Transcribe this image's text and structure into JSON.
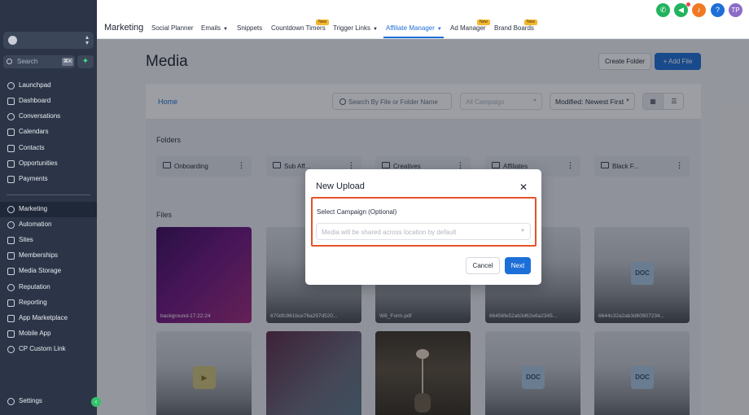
{
  "sidebar": {
    "search_placeholder": "Search",
    "search_shortcut": "⌘K",
    "items": [
      {
        "label": "Launchpad",
        "icon": "rocket-icon"
      },
      {
        "label": "Dashboard",
        "icon": "dashboard-icon"
      },
      {
        "label": "Conversations",
        "icon": "chat-icon"
      },
      {
        "label": "Calendars",
        "icon": "calendar-icon"
      },
      {
        "label": "Contacts",
        "icon": "contacts-icon"
      },
      {
        "label": "Opportunities",
        "icon": "opportunities-icon"
      },
      {
        "label": "Payments",
        "icon": "payments-icon"
      },
      {
        "label": "Marketing",
        "icon": "send-icon"
      },
      {
        "label": "Automation",
        "icon": "automation-icon"
      },
      {
        "label": "Sites",
        "icon": "sites-icon"
      },
      {
        "label": "Memberships",
        "icon": "memberships-icon"
      },
      {
        "label": "Media Storage",
        "icon": "media-icon"
      },
      {
        "label": "Reputation",
        "icon": "star-icon"
      },
      {
        "label": "Reporting",
        "icon": "reporting-icon"
      },
      {
        "label": "App Marketplace",
        "icon": "marketplace-icon"
      },
      {
        "label": "Mobile App",
        "icon": "mobile-icon"
      },
      {
        "label": "CP Custom Link",
        "icon": "link-icon"
      }
    ],
    "settings_label": "Settings",
    "active_item": "Marketing"
  },
  "topbar": {
    "title": "Marketing",
    "tabs": [
      {
        "label": "Social Planner"
      },
      {
        "label": "Emails",
        "dropdown": true
      },
      {
        "label": "Snippets"
      },
      {
        "label": "Countdown Timers",
        "badge": "New"
      },
      {
        "label": "Trigger Links",
        "dropdown": true
      },
      {
        "label": "Affiliate Manager",
        "dropdown": true,
        "active": true
      },
      {
        "label": "Ad Manager",
        "badge": "New"
      },
      {
        "label": "Brand Boards",
        "badge": "New"
      }
    ],
    "avatar_initials": "TP",
    "accent_color": "#1d6fd8"
  },
  "page": {
    "title": "Media",
    "create_folder_label": "Create Folder",
    "add_file_label": "Add File",
    "breadcrumb_home": "Home",
    "search_placeholder": "Search By File or Folder Name",
    "campaign_placeholder": "All Campaign",
    "sort_value": "Modified: Newest First",
    "folders_heading": "Folders",
    "files_heading": "Files",
    "folders": [
      "Onboarding",
      "Sub Aff...",
      "Creatives",
      "Affiliates",
      "Black F..."
    ],
    "files": [
      {
        "name": "background-17:22:24",
        "kind": "image"
      },
      {
        "name": "670dfc961bce76a297d520...",
        "kind": "image"
      },
      {
        "name": "W8_Form.pdf",
        "kind": "pdf"
      },
      {
        "name": "66456fe52ab3d62e6a2345...",
        "kind": "image"
      },
      {
        "name": "6644c32a2ab3d60907234...",
        "kind": "doc",
        "badge": "DOC"
      },
      {
        "name": "",
        "kind": "video"
      },
      {
        "name": "",
        "kind": "image"
      },
      {
        "name": "",
        "kind": "photo"
      },
      {
        "name": "",
        "kind": "doc",
        "badge": "DOC"
      },
      {
        "name": "",
        "kind": "doc",
        "badge": "DOC"
      }
    ]
  },
  "modal": {
    "title": "New Upload",
    "field_label": "Select Campaign (Optional)",
    "field_placeholder": "Media will be shared across location by default",
    "cancel_label": "Cancel",
    "next_label": "Next",
    "highlight_color": "#e5522a"
  }
}
